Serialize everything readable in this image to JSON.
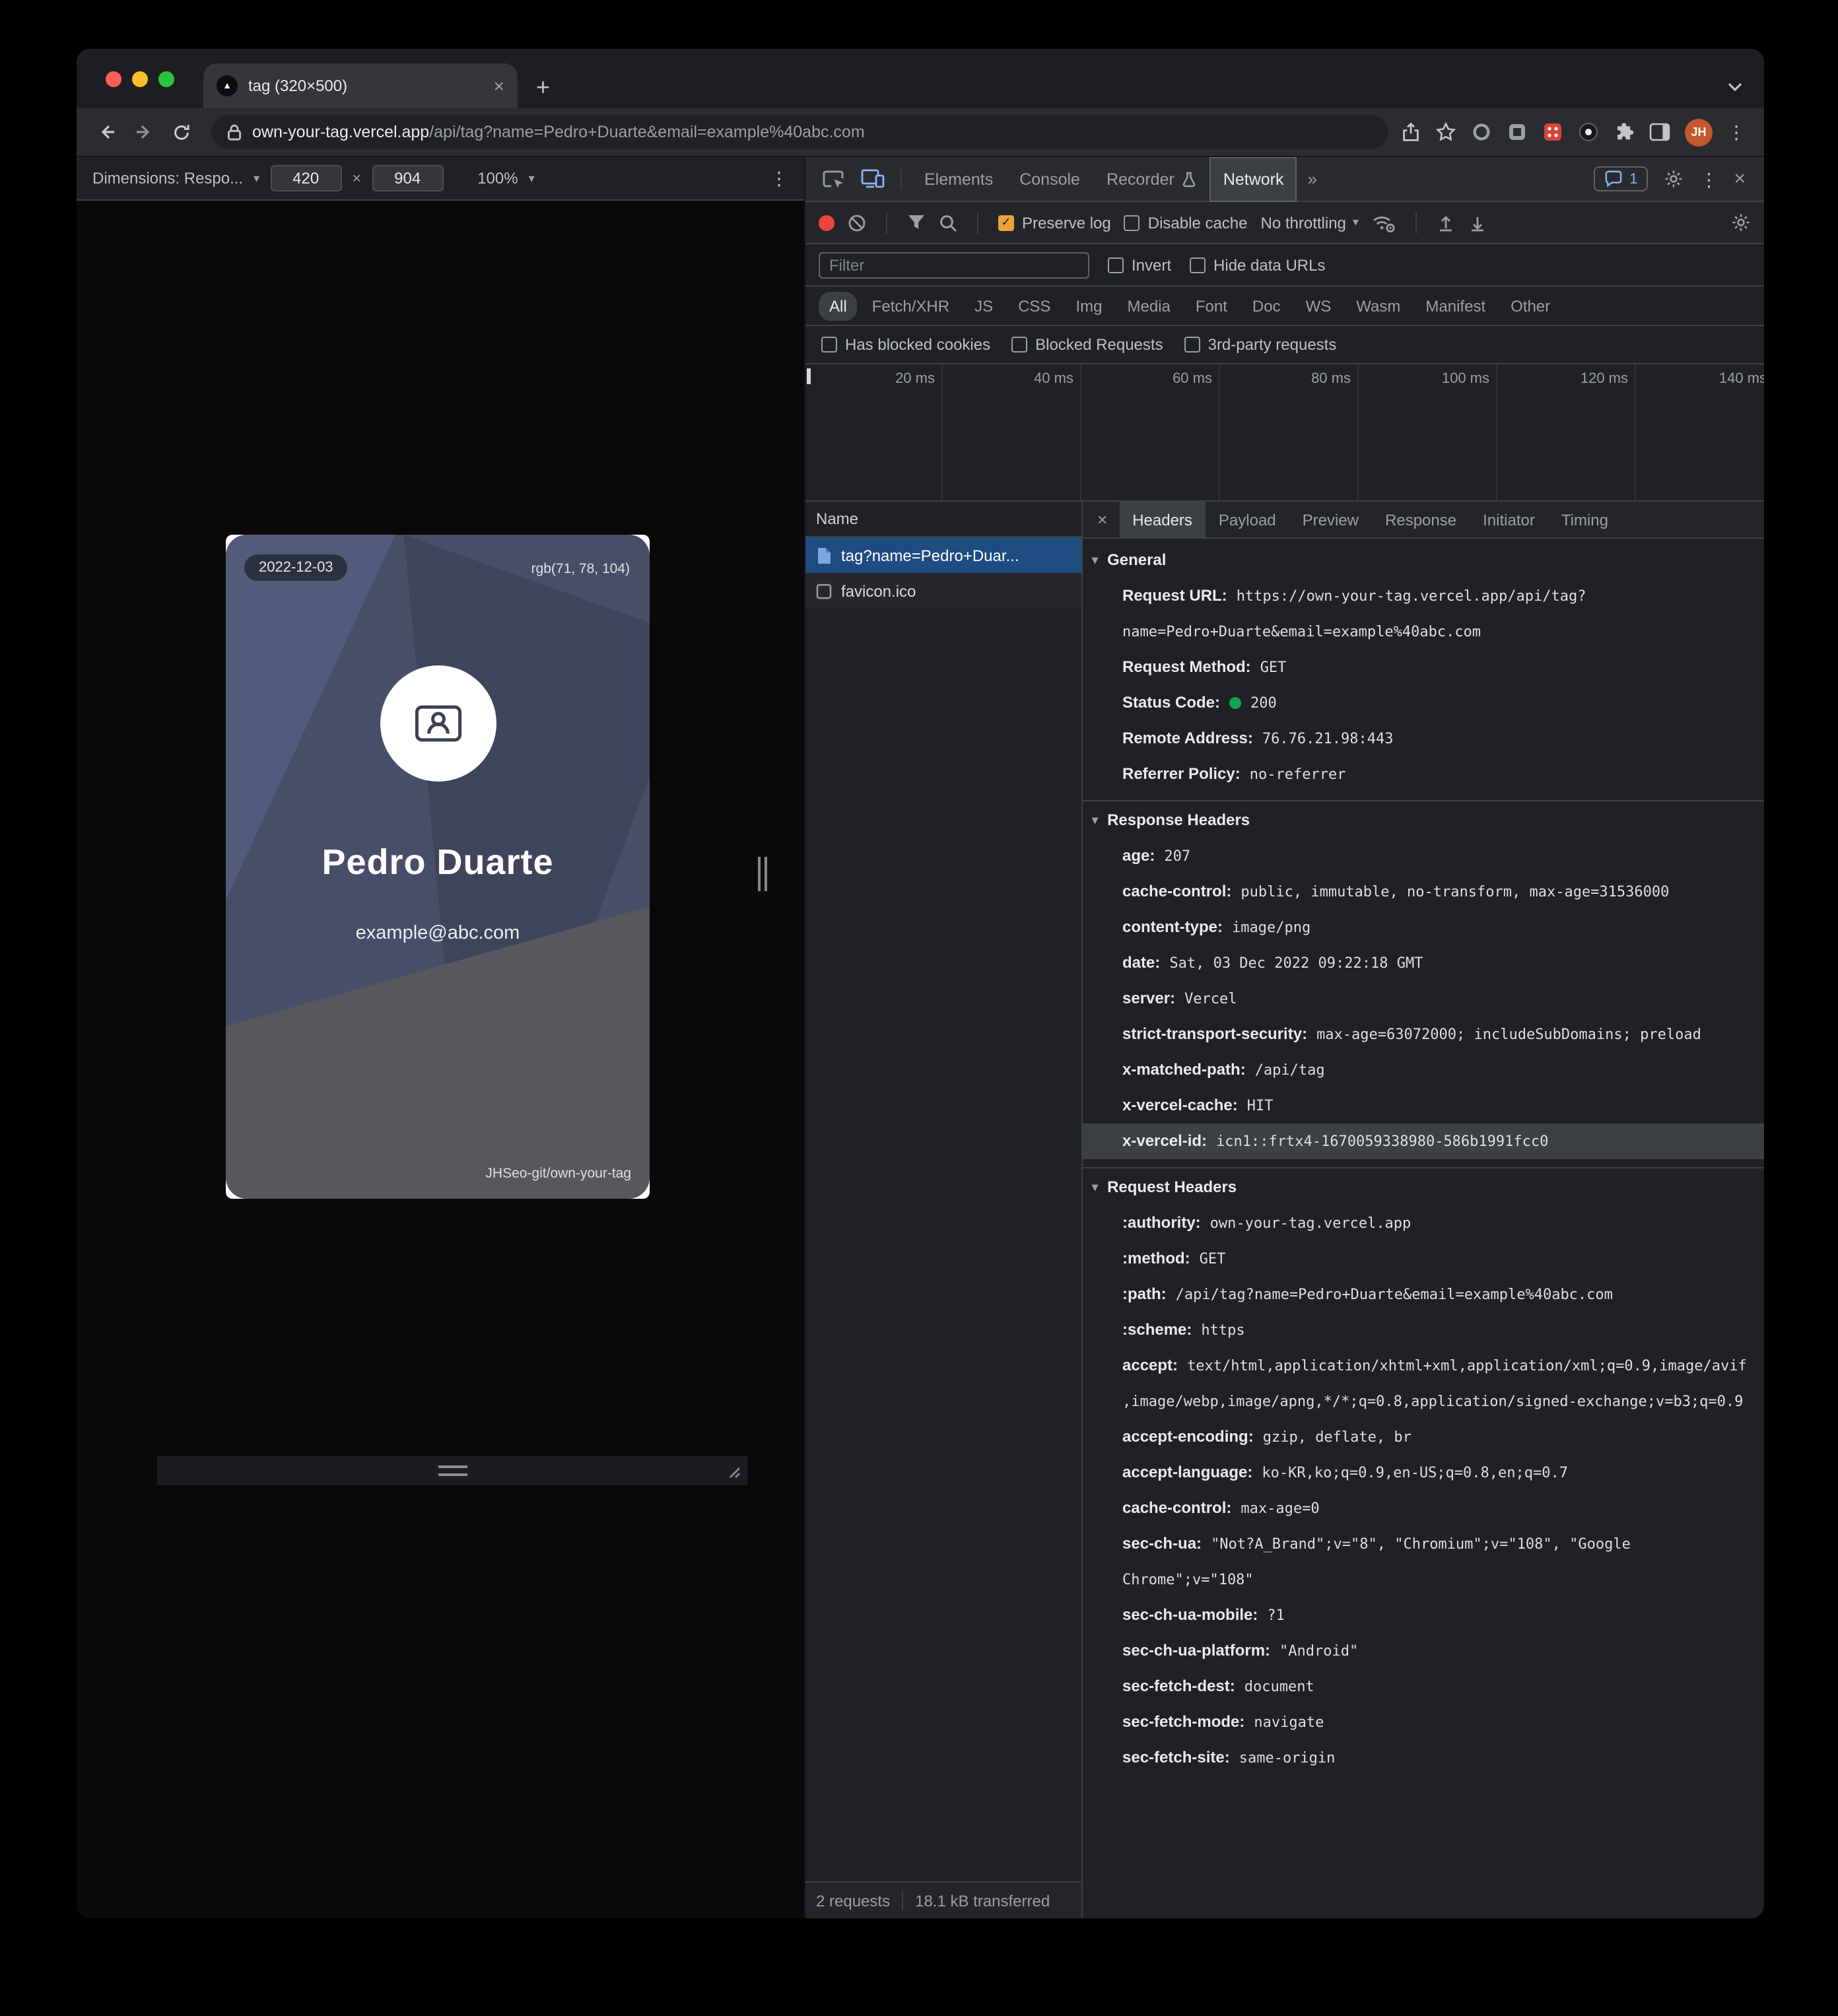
{
  "window": {
    "tab": {
      "title": "tag (320×500)"
    },
    "address": {
      "domain": "own-your-tag.vercel.app",
      "path": "/api/tag?name=Pedro+Duarte&email=example%40abc.com"
    },
    "profile_initials": "JH"
  },
  "device_toolbar": {
    "dimensions_label": "Dimensions: Respo...",
    "width": "420",
    "separator": "×",
    "height": "904",
    "zoom": "100%"
  },
  "card": {
    "date": "2022-12-03",
    "color": "rgb(71, 78, 104)",
    "name": "Pedro Duarte",
    "email": "example@abc.com",
    "repo": "JHSeo-git/own-your-tag"
  },
  "devtools": {
    "tabs": [
      "Elements",
      "Console",
      "Recorder",
      "Network"
    ],
    "active_tab": "Network",
    "more": "»",
    "issues_count": "1",
    "toolbar": {
      "preserve_log": "Preserve log",
      "disable_cache": "Disable cache",
      "throttling": "No throttling"
    },
    "filter": {
      "placeholder": "Filter",
      "invert": "Invert",
      "hide_data_urls": "Hide data URLs"
    },
    "chips": [
      "All",
      "Fetch/XHR",
      "JS",
      "CSS",
      "Img",
      "Media",
      "Font",
      "Doc",
      "WS",
      "Wasm",
      "Manifest",
      "Other"
    ],
    "chips_active": "All",
    "request_filters": [
      "Has blocked cookies",
      "Blocked Requests",
      "3rd-party requests"
    ],
    "timeline_labels": [
      "20 ms",
      "40 ms",
      "60 ms",
      "80 ms",
      "100 ms",
      "120 ms",
      "140 ms"
    ],
    "requests": {
      "column": "Name",
      "rows": [
        {
          "name": "tag?name=Pedro+Duar...",
          "icon": "document",
          "selected": true
        },
        {
          "name": "favicon.ico",
          "icon": "file",
          "selected": false
        }
      ]
    },
    "detail_tabs": [
      "Headers",
      "Payload",
      "Preview",
      "Response",
      "Initiator",
      "Timing"
    ],
    "active_detail_tab": "Headers",
    "sections": [
      {
        "title": "General",
        "rows": [
          {
            "k": "Request URL:",
            "v": "https://own-your-tag.vercel.app/api/tag?name=Pedro+Duarte&email=example%40abc.com"
          },
          {
            "k": "Request Method:",
            "v": "GET"
          },
          {
            "k": "Status Code:",
            "v": "200",
            "status": "green"
          },
          {
            "k": "Remote Address:",
            "v": "76.76.21.98:443"
          },
          {
            "k": "Referrer Policy:",
            "v": "no-referrer"
          }
        ]
      },
      {
        "title": "Response Headers",
        "rows": [
          {
            "k": "age:",
            "v": "207"
          },
          {
            "k": "cache-control:",
            "v": "public, immutable, no-transform, max-age=31536000"
          },
          {
            "k": "content-type:",
            "v": "image/png"
          },
          {
            "k": "date:",
            "v": "Sat, 03 Dec 2022 09:22:18 GMT"
          },
          {
            "k": "server:",
            "v": "Vercel"
          },
          {
            "k": "strict-transport-security:",
            "v": "max-age=63072000; includeSubDomains; preload"
          },
          {
            "k": "x-matched-path:",
            "v": "/api/tag"
          },
          {
            "k": "x-vercel-cache:",
            "v": "HIT"
          },
          {
            "k": "x-vercel-id:",
            "v": "icn1::frtx4-1670059338980-586b1991fcc0",
            "highlight": true
          }
        ]
      },
      {
        "title": "Request Headers",
        "rows": [
          {
            "k": ":authority:",
            "v": "own-your-tag.vercel.app"
          },
          {
            "k": ":method:",
            "v": "GET"
          },
          {
            "k": ":path:",
            "v": "/api/tag?name=Pedro+Duarte&email=example%40abc.com"
          },
          {
            "k": ":scheme:",
            "v": "https"
          },
          {
            "k": "accept:",
            "v": "text/html,application/xhtml+xml,application/xml;q=0.9,image/avif,image/webp,image/apng,*/*;q=0.8,application/signed-exchange;v=b3;q=0.9"
          },
          {
            "k": "accept-encoding:",
            "v": "gzip, deflate, br"
          },
          {
            "k": "accept-language:",
            "v": "ko-KR,ko;q=0.9,en-US;q=0.8,en;q=0.7"
          },
          {
            "k": "cache-control:",
            "v": "max-age=0"
          },
          {
            "k": "sec-ch-ua:",
            "v": "\"Not?A_Brand\";v=\"8\", \"Chromium\";v=\"108\", \"Google Chrome\";v=\"108\""
          },
          {
            "k": "sec-ch-ua-mobile:",
            "v": "?1"
          },
          {
            "k": "sec-ch-ua-platform:",
            "v": "\"Android\""
          },
          {
            "k": "sec-fetch-dest:",
            "v": "document"
          },
          {
            "k": "sec-fetch-mode:",
            "v": "navigate"
          },
          {
            "k": "sec-fetch-site:",
            "v": "same-origin"
          }
        ]
      }
    ],
    "status_bar": {
      "requests": "2 requests",
      "transferred": "18.1 kB transferred"
    }
  }
}
